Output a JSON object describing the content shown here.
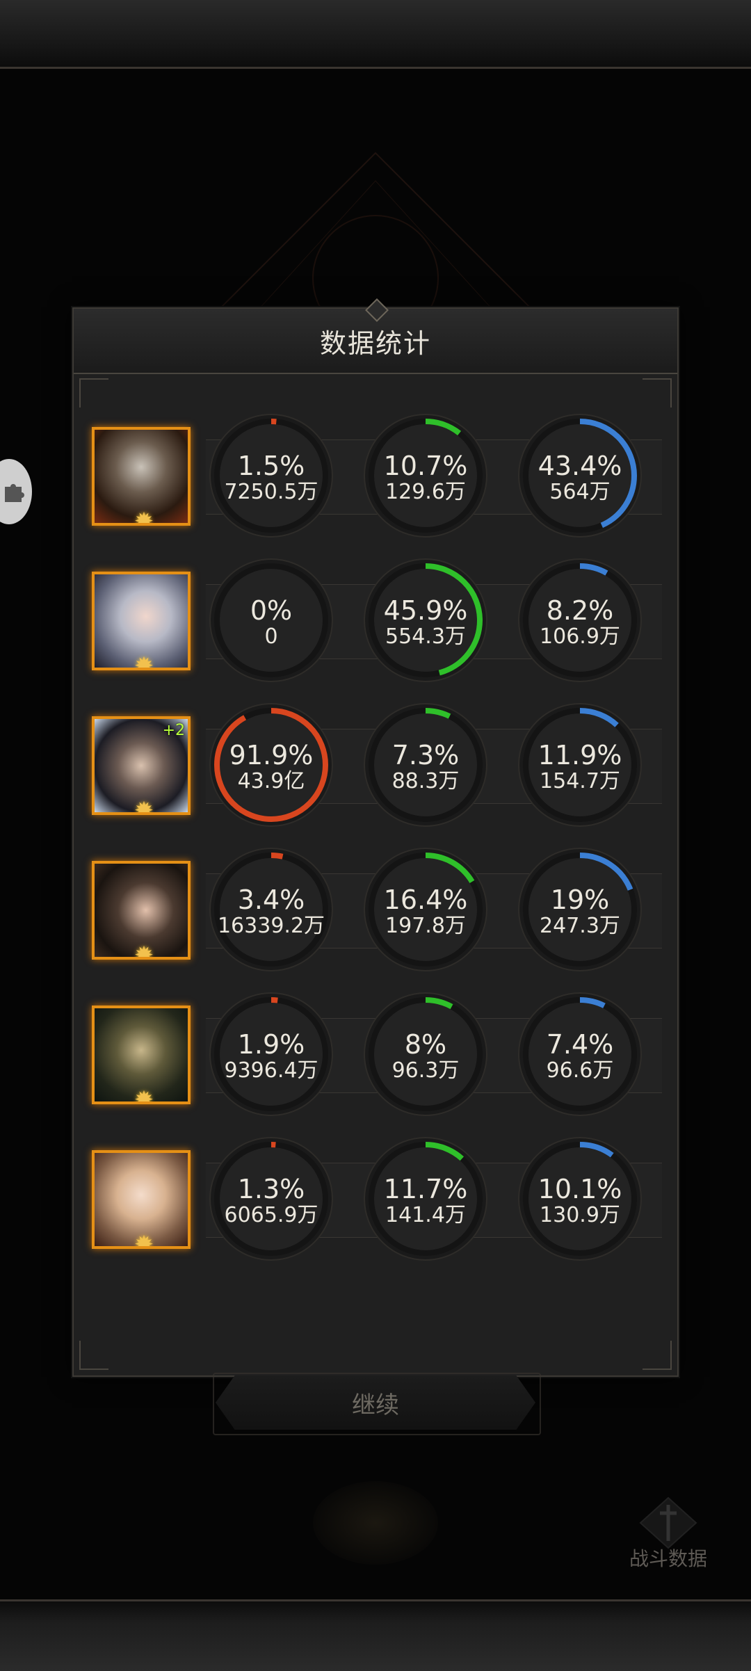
{
  "title": "数据统计",
  "columns": [
    {
      "icon": "sword-icon",
      "color": "#e0301e"
    },
    {
      "icon": "heal-cross-icon",
      "color": "#2ecc2e"
    },
    {
      "icon": "shield-icon",
      "color": "#2fb0e8"
    }
  ],
  "heroes": [
    {
      "avatar": "dragon-skull-hero-avatar",
      "plus": "",
      "damage": {
        "pct": "1.5%",
        "value": "7250.5万",
        "fraction": 0.015
      },
      "heal": {
        "pct": "10.7%",
        "value": "129.6万",
        "fraction": 0.107
      },
      "tank": {
        "pct": "43.4%",
        "value": "564万",
        "fraction": 0.434
      }
    },
    {
      "avatar": "silver-hair-heroine-avatar",
      "plus": "",
      "damage": {
        "pct": "0%",
        "value": "0",
        "fraction": 0
      },
      "heal": {
        "pct": "45.9%",
        "value": "554.3万",
        "fraction": 0.459
      },
      "tank": {
        "pct": "8.2%",
        "value": "106.9万",
        "fraction": 0.082
      }
    },
    {
      "avatar": "dark-hair-warrior-avatar",
      "plus": "+2",
      "damage": {
        "pct": "91.9%",
        "value": "43.9亿",
        "fraction": 0.919
      },
      "heal": {
        "pct": "7.3%",
        "value": "88.3万",
        "fraction": 0.073
      },
      "tank": {
        "pct": "11.9%",
        "value": "154.7万",
        "fraction": 0.119
      }
    },
    {
      "avatar": "dark-hair-heroine-avatar",
      "plus": "",
      "damage": {
        "pct": "3.4%",
        "value": "16339.2万",
        "fraction": 0.034
      },
      "heal": {
        "pct": "16.4%",
        "value": "197.8万",
        "fraction": 0.164
      },
      "tank": {
        "pct": "19%",
        "value": "247.3万",
        "fraction": 0.19
      }
    },
    {
      "avatar": "hooded-mage-avatar",
      "plus": "",
      "damage": {
        "pct": "1.9%",
        "value": "9396.4万",
        "fraction": 0.019
      },
      "heal": {
        "pct": "8%",
        "value": "96.3万",
        "fraction": 0.08
      },
      "tank": {
        "pct": "7.4%",
        "value": "96.6万",
        "fraction": 0.074
      }
    },
    {
      "avatar": "blonde-heroine-avatar",
      "plus": "",
      "damage": {
        "pct": "1.3%",
        "value": "6065.9万",
        "fraction": 0.013
      },
      "heal": {
        "pct": "11.7%",
        "value": "141.4万",
        "fraction": 0.117
      },
      "tank": {
        "pct": "10.1%",
        "value": "130.9万",
        "fraction": 0.101
      }
    }
  ],
  "ring_colors": {
    "damage": "#d8461f",
    "heal": "#2fbf2a",
    "tank": "#3b7fd4",
    "track": "#141414"
  },
  "continue_label": "继续",
  "battle_data_label": "战斗数据"
}
